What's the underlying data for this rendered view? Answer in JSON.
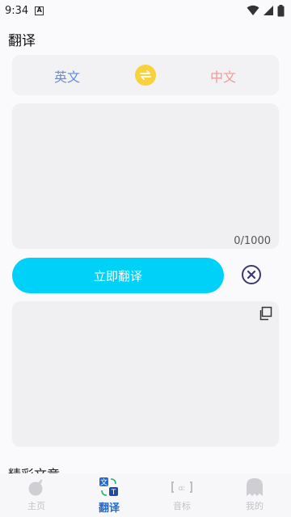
{
  "status_bar": {
    "time": "9:34",
    "badge": "A"
  },
  "app": {
    "title": "翻译"
  },
  "lang": {
    "source": "英文",
    "target": "中文",
    "swap_color": "#f7d13e"
  },
  "input": {
    "placeholder": "",
    "value": "",
    "counter": "0/1000"
  },
  "action": {
    "translate_label": "立即翻译",
    "color": "#00d1f8"
  },
  "section": {
    "title": "精彩文章"
  },
  "nav": {
    "items": [
      {
        "label": "主页",
        "icon": "bomb-icon"
      },
      {
        "label": "翻译",
        "icon": "translate-icon"
      },
      {
        "label": "音标",
        "icon": "phonetic-icon"
      },
      {
        "label": "我的",
        "icon": "ghost-icon"
      }
    ],
    "active_color": "#1f6bd1"
  }
}
